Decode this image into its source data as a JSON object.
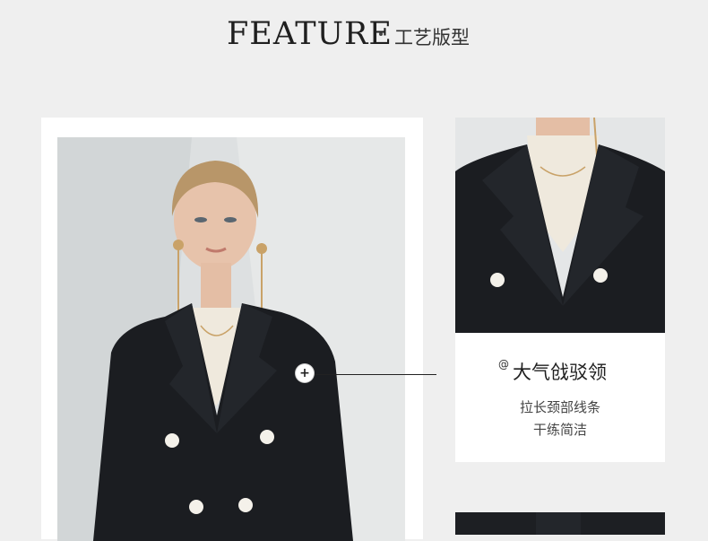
{
  "header": {
    "title": "FEATURE",
    "subtitle": "工艺版型"
  },
  "callout": {
    "marker": "+"
  },
  "caption": {
    "at": "@",
    "title": "大气戗驳领",
    "lines": [
      "拉长颈部线条",
      "干练简洁"
    ]
  },
  "colors": {
    "background": "#efefef",
    "jacket": "#1b1d21",
    "button": "#f4f1ea",
    "hair": "#b89669"
  }
}
